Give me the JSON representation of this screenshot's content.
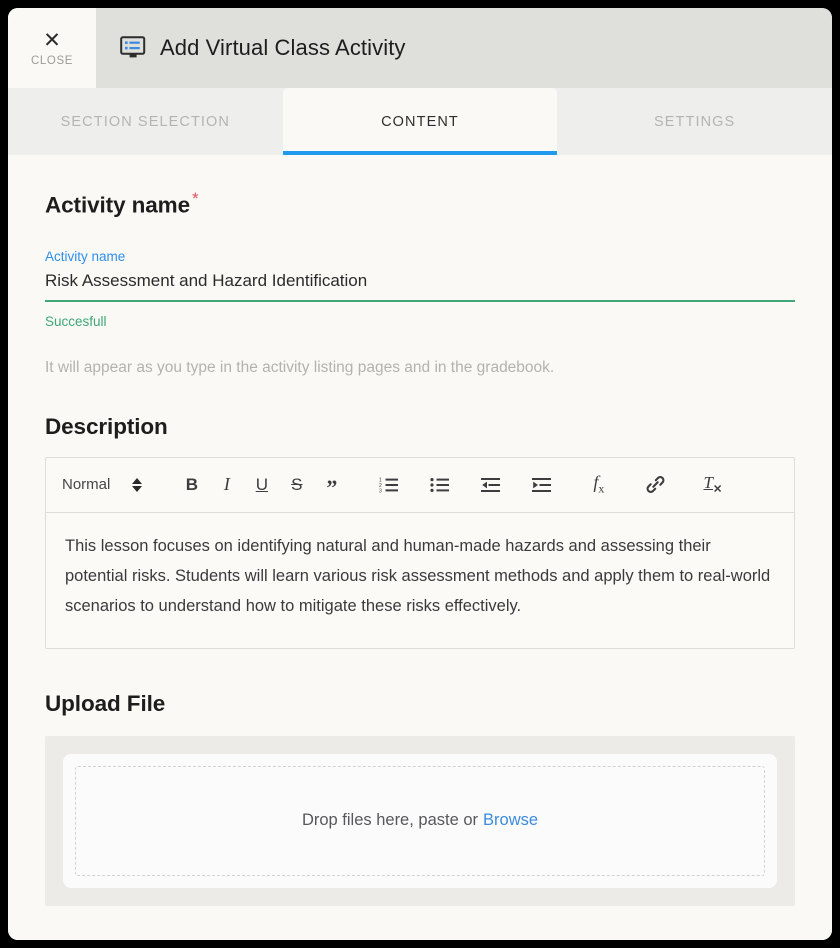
{
  "window": {
    "close_button": {
      "icon": "close-icon",
      "glyph": "✕",
      "label": "CLOSE"
    },
    "title": "Add Virtual Class Activity",
    "title_icon": "virtual-class-monitor-icon"
  },
  "tabs": [
    {
      "label": "SECTION SELECTION",
      "active": false
    },
    {
      "label": "CONTENT",
      "active": true
    },
    {
      "label": "SETTINGS",
      "active": false
    }
  ],
  "activity_name_section": {
    "heading": "Activity name",
    "required_marker": "*",
    "field_label": "Activity name",
    "field_value": "Risk Assessment and Hazard Identification",
    "field_placeholder": "Activity name",
    "validation_message": "Succesfull",
    "hint": "It will appear as you type in the activity listing pages and in the gradebook."
  },
  "description_section": {
    "heading": "Description",
    "toolbar": {
      "format_select": "Normal",
      "buttons": [
        {
          "name": "bold",
          "glyph": "B"
        },
        {
          "name": "italic",
          "glyph": "I"
        },
        {
          "name": "underline",
          "glyph": "U"
        },
        {
          "name": "strikethrough",
          "glyph": "S"
        },
        {
          "name": "blockquote",
          "glyph": "”"
        },
        {
          "name": "ordered-list",
          "glyph": ""
        },
        {
          "name": "bullet-list",
          "glyph": ""
        },
        {
          "name": "outdent",
          "glyph": ""
        },
        {
          "name": "indent",
          "glyph": ""
        },
        {
          "name": "formula",
          "glyph": "fx"
        },
        {
          "name": "link",
          "glyph": ""
        },
        {
          "name": "clear-formatting",
          "glyph": "Tx"
        }
      ]
    },
    "content": "This lesson focuses on identifying natural and human-made hazards and assessing their potential risks. Students will learn various risk assessment methods and apply them to real-world scenarios to understand how to mitigate these risks effectively."
  },
  "upload_section": {
    "heading": "Upload File",
    "dropzone_text": "Drop files here, paste or",
    "browse_label": "Browse"
  },
  "colors": {
    "accent_blue": "#1f9aef",
    "label_blue": "#2d8fea",
    "success_green": "#3fa777",
    "required_red": "#e05260",
    "link_blue": "#3c8bdc",
    "header_bg": "#dfdfdc",
    "tabbar_bg": "#eeeeec",
    "body_bg": "#faf9f6"
  }
}
